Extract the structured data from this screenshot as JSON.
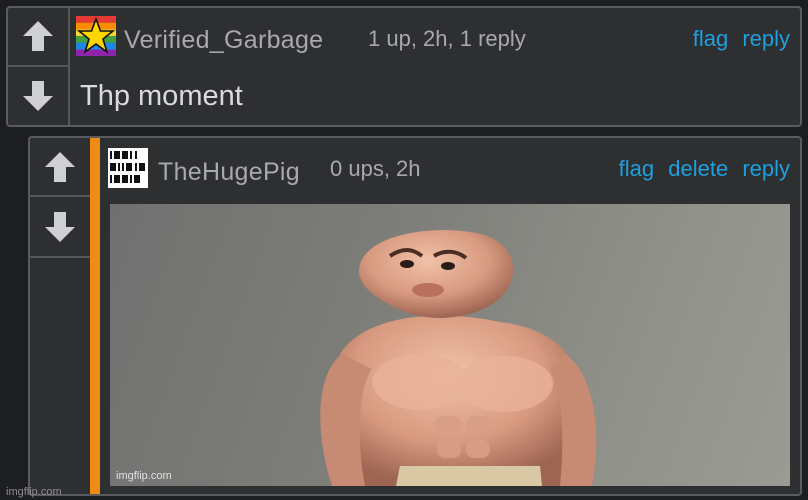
{
  "comments": [
    {
      "username": "Verified_Garbage",
      "meta": "1 up, 2h, 1 reply",
      "actions": [
        "flag",
        "reply"
      ],
      "text": "Thp moment",
      "avatar": "rainbow-star-icon"
    },
    {
      "username": "TheHugePig",
      "meta": "0 ups, 2h",
      "actions": [
        "flag",
        "delete",
        "reply"
      ],
      "image_watermark": "imgflip.com",
      "avatar": "binary-pattern-icon"
    }
  ],
  "footer": {
    "watermark": "imgflip.com"
  },
  "colors": {
    "background": "#1d1e20",
    "panel": "#2e2f31",
    "accent": "#f08c14",
    "link": "#1e9fdf",
    "muted_text": "#a8a9ab"
  }
}
